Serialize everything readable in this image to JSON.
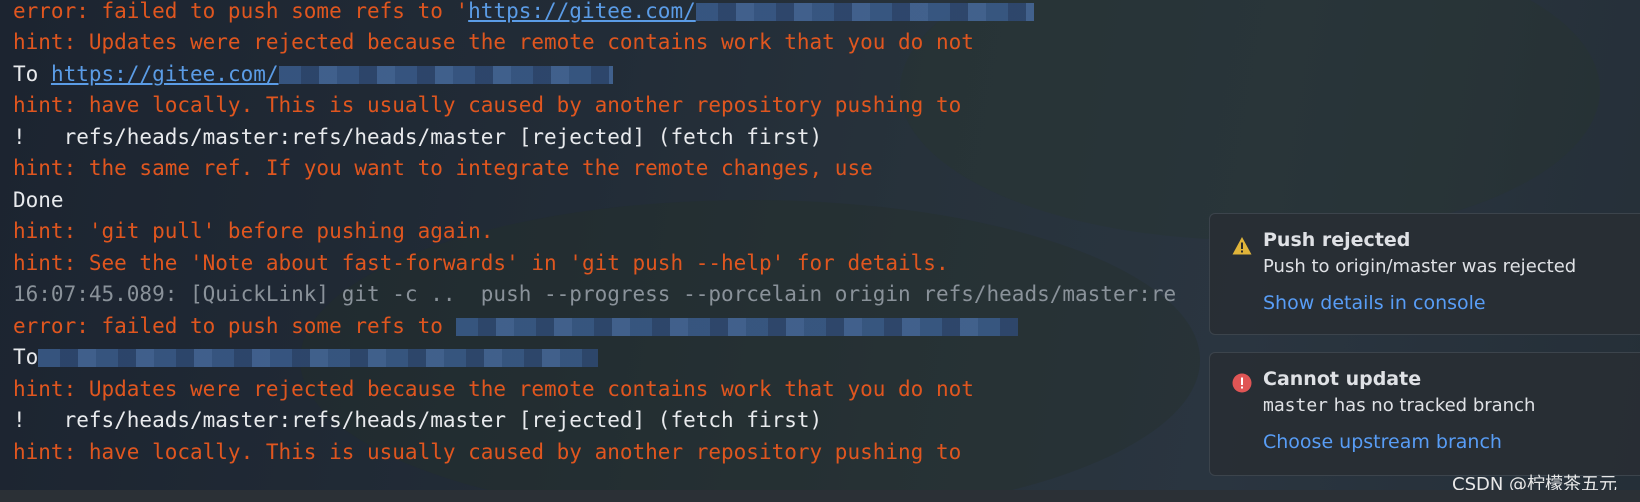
{
  "console": {
    "lines": [
      {
        "kind": "err",
        "text": "error: failed to push some refs to '",
        "link": "https://gitee.com/",
        "blurred": true
      },
      {
        "kind": "err",
        "text": "hint: Updates were rejected because the remote contains work that you do not"
      },
      {
        "kind": "norm",
        "text": "To ",
        "link": "https://gitee.com/",
        "blurred": true
      },
      {
        "kind": "err",
        "text": "hint: have locally. This is usually caused by another repository pushing to"
      },
      {
        "kind": "norm",
        "text": "!   refs/heads/master:refs/heads/master [rejected] (fetch first)"
      },
      {
        "kind": "err",
        "text": "hint: the same ref. If you want to integrate the remote changes, use"
      },
      {
        "kind": "norm",
        "text": "Done"
      },
      {
        "kind": "err",
        "text": "hint: 'git pull' before pushing again."
      },
      {
        "kind": "err",
        "text": "hint: See the 'Note about fast-forwards' in 'git push --help' for details."
      },
      {
        "kind": "dim",
        "text": "16:07:45.089: [QuickLink] git -c ..  push --progress --porcelain origin refs/heads/master:re"
      },
      {
        "kind": "err",
        "text": "error: failed to push some refs to ",
        "blurred": true
      },
      {
        "kind": "norm",
        "text": "To",
        "blurred": true
      },
      {
        "kind": "err",
        "text": "hint: Updates were rejected because the remote contains work that you do not"
      },
      {
        "kind": "norm",
        "text": "!   refs/heads/master:refs/heads/master [rejected] (fetch first)"
      },
      {
        "kind": "err",
        "text": "hint: have locally. This is usually caused by another repository pushing to"
      }
    ]
  },
  "notifications": [
    {
      "type": "warning",
      "title": "Push rejected",
      "body": "Push to origin/master was rejected",
      "action": "Show details in console"
    },
    {
      "type": "error",
      "title": "Cannot update",
      "body_code": "master",
      "body_rest": " has no tracked branch",
      "action": "Choose upstream branch"
    }
  ],
  "watermark": "CSDN @柠檬茶五元",
  "colors": {
    "error_text": "#e0561f",
    "link": "#5b9ce6",
    "warning_icon": "#e0b43a",
    "error_icon": "#e05555",
    "action_link": "#589df6"
  }
}
